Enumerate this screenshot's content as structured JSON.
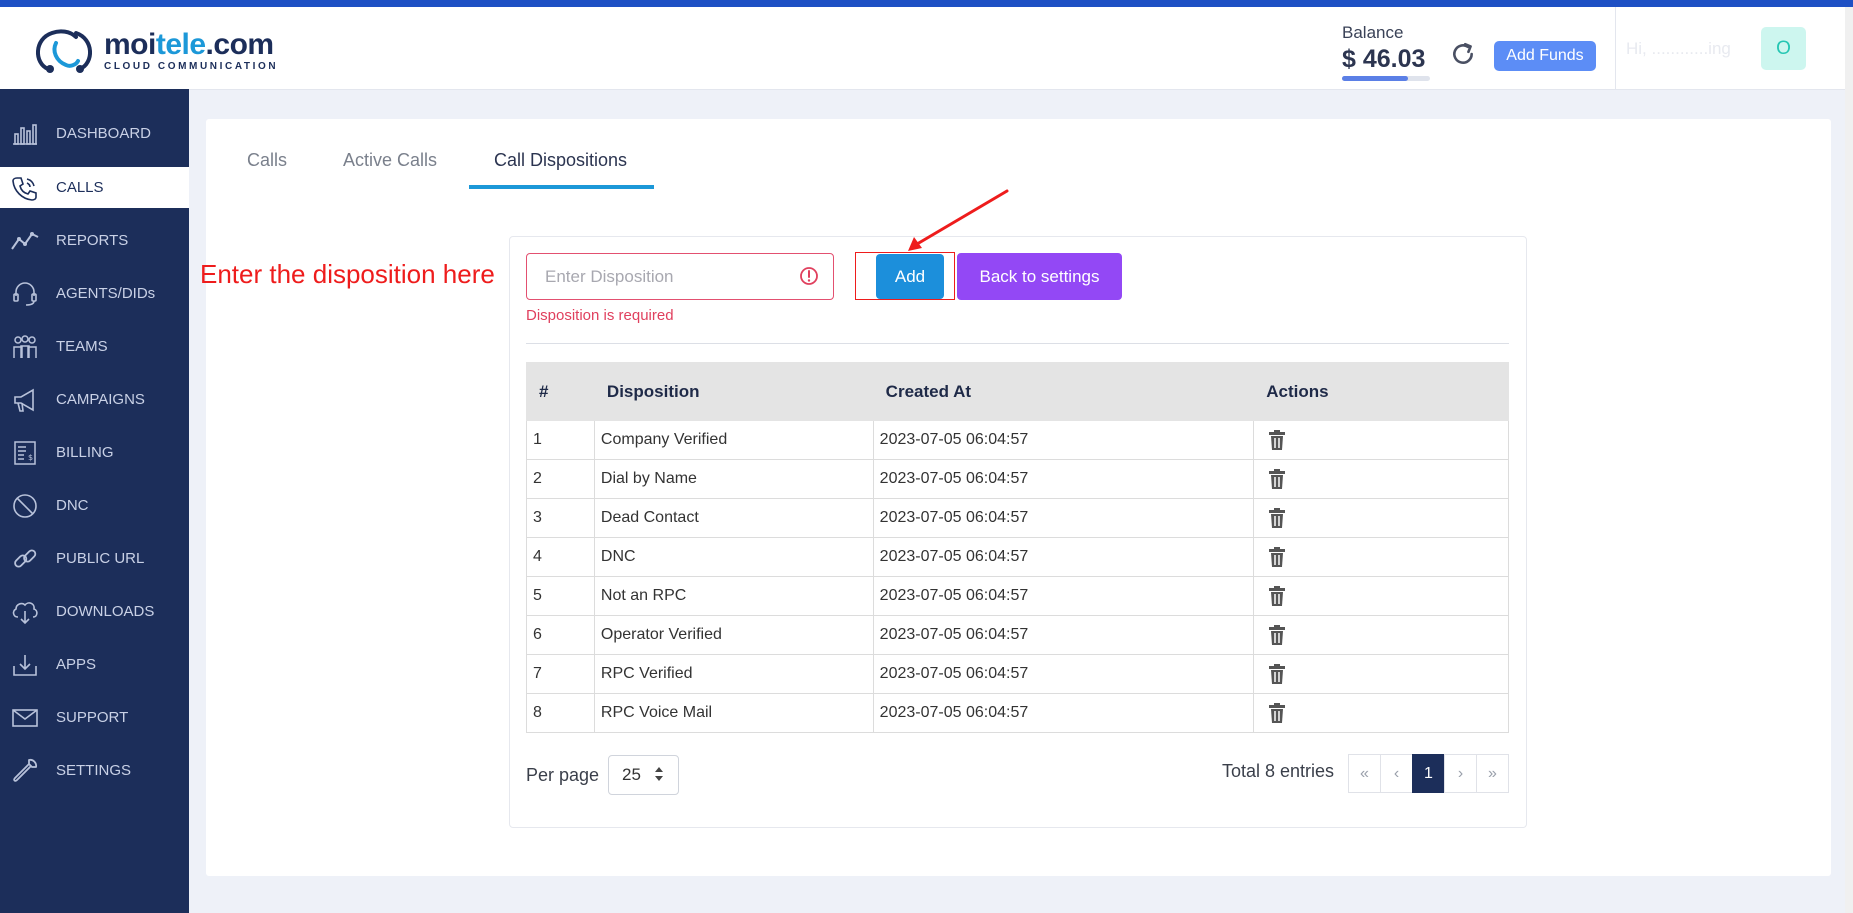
{
  "header": {
    "logo_main_1": "moi",
    "logo_main_2": "tele",
    "logo_main_3": ".com",
    "logo_sub": "CLOUD COMMUNICATION",
    "balance_label": "Balance",
    "balance_value": "$ 46.03",
    "add_funds_label": "Add Funds",
    "user_text": "Hi, ............ing",
    "avatar_initial": "O"
  },
  "sidebar": {
    "items": [
      {
        "label": "DASHBOARD",
        "icon": "dashboard-icon"
      },
      {
        "label": "CALLS",
        "icon": "phone-icon",
        "active": true
      },
      {
        "label": "REPORTS",
        "icon": "reports-icon"
      },
      {
        "label": "AGENTS/DIDs",
        "icon": "headset-icon"
      },
      {
        "label": "TEAMS",
        "icon": "teams-icon"
      },
      {
        "label": "CAMPAIGNS",
        "icon": "megaphone-icon"
      },
      {
        "label": "BILLING",
        "icon": "billing-icon"
      },
      {
        "label": "DNC",
        "icon": "block-icon"
      },
      {
        "label": "PUBLIC URL",
        "icon": "link-icon"
      },
      {
        "label": "DOWNLOADS",
        "icon": "cloud-download-icon"
      },
      {
        "label": "APPS",
        "icon": "apps-icon"
      },
      {
        "label": "SUPPORT",
        "icon": "mail-icon"
      },
      {
        "label": "SETTINGS",
        "icon": "wrench-icon"
      }
    ]
  },
  "tabs": [
    {
      "label": "Calls"
    },
    {
      "label": "Active Calls"
    },
    {
      "label": "Call Dispositions",
      "active": true
    }
  ],
  "annotation": {
    "text": "Enter the disposition here",
    "color": "#ee1c1c"
  },
  "form": {
    "input_placeholder": "Enter Disposition",
    "input_value": "",
    "error_message": "Disposition is required",
    "add_label": "Add",
    "back_label": "Back to settings"
  },
  "table": {
    "headers": [
      "#",
      "Disposition",
      "Created At",
      "Actions"
    ],
    "rows": [
      {
        "num": "1",
        "disposition": "Company Verified",
        "created_at": "2023-07-05 06:04:57"
      },
      {
        "num": "2",
        "disposition": "Dial by Name",
        "created_at": "2023-07-05 06:04:57"
      },
      {
        "num": "3",
        "disposition": "Dead Contact",
        "created_at": "2023-07-05 06:04:57"
      },
      {
        "num": "4",
        "disposition": "DNC",
        "created_at": "2023-07-05 06:04:57"
      },
      {
        "num": "5",
        "disposition": "Not an RPC",
        "created_at": "2023-07-05 06:04:57"
      },
      {
        "num": "6",
        "disposition": "Operator Verified",
        "created_at": "2023-07-05 06:04:57"
      },
      {
        "num": "7",
        "disposition": "RPC Verified",
        "created_at": "2023-07-05 06:04:57"
      },
      {
        "num": "8",
        "disposition": "RPC Voice Mail",
        "created_at": "2023-07-05 06:04:57"
      }
    ]
  },
  "pagination": {
    "per_page_label": "Per page",
    "per_page_value": "25",
    "total_text": "Total 8 entries",
    "first": "«",
    "prev": "‹",
    "current": "1",
    "next": "›",
    "last": "»"
  },
  "colors": {
    "sidebar_bg": "#1c2e5a",
    "accent_blue": "#1c8fdb",
    "back_button_purple": "#9348f5",
    "add_funds_blue": "#5c8df6",
    "error_red": "#e0405e"
  }
}
